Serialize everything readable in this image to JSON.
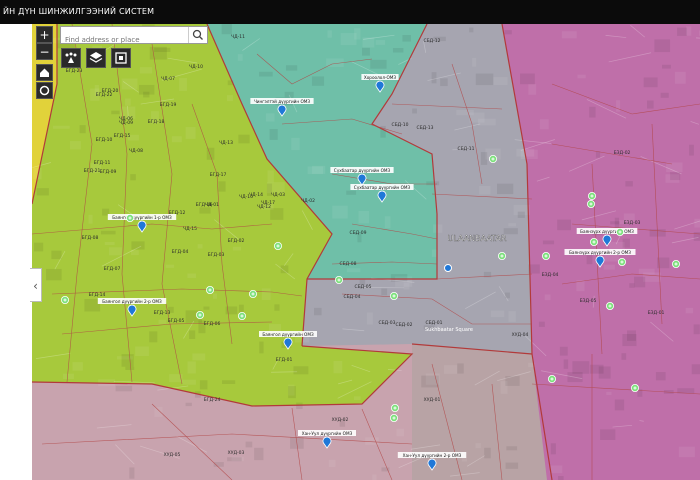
{
  "app": {
    "title": "ЙН ДҮН ШИНЖИЛГЭЭНИЙ СИСТЕМ"
  },
  "search": {
    "placeholder": "Find address or place"
  },
  "controls": {
    "zoom_in": "+",
    "zoom_out": "−",
    "collapse": "‹"
  },
  "icons": [
    "zoom-in-icon",
    "zoom-out-icon",
    "home-icon",
    "locate-icon",
    "legend-icon",
    "layers-icon",
    "basemap-icon",
    "search-icon",
    "collapse-arrow-icon"
  ],
  "colors": {
    "district_yellow": "#e3d33a",
    "district_green": "#a6c83a",
    "district_teal": "#6dbea6",
    "district_gray": "#a8a8b2",
    "district_magenta": "#c06aa8",
    "district_pink": "#c79aa8",
    "boundary": "#b23a3a",
    "marker_blue": "#1f78d8",
    "marker_green": "#6fd06f"
  },
  "districts": {
    "center": "ULAANBAATAR",
    "landmark": "Sukhbaatar Square"
  },
  "zone_labels": [
    "ЧД-11",
    "ЧД-10",
    "ЧД-07",
    "ЧД-08",
    "ЧД-06",
    "ЧД-09",
    "ЧД-13",
    "ЧД-16",
    "ЧД-17",
    "ЧД-14",
    "ЧД-12",
    "ЧД-15",
    "ЧД-01",
    "ЧД-02",
    "ЧД-03",
    "БГД-23",
    "БГД-22",
    "БГД-21",
    "БГД-20",
    "БГД-19",
    "БГД-18",
    "БГД-17",
    "БГД-16",
    "БГД-15",
    "БГД-14",
    "БГД-13",
    "БГД-12",
    "БГД-11",
    "БГД-10",
    "БГД-09",
    "БГД-08",
    "БГД-07",
    "БГД-06",
    "БГД-05",
    "БГД-04",
    "БГД-03",
    "БГД-02",
    "БГД-01",
    "БГД-24",
    "СБД-12",
    "СБД-13",
    "СБД-10",
    "СБД-09",
    "СБД-08",
    "СБД-05",
    "СБД-04",
    "СБД-03",
    "СБД-02",
    "СБД-01",
    "СБД-11",
    "БЗД-02",
    "БЗД-03",
    "БЗД-04",
    "БЗД-05",
    "БЗД-01",
    "ХУД-03",
    "ХУД-02",
    "ХУД-01",
    "ХУД-04",
    "ХУД-05"
  ],
  "station_labels": [
    "Хороолол-ОМЗ",
    "Чингэлтэй дүүргийн ОМЗ",
    "Баянгол дүүргийн 1-р ОМЗ",
    "Баянгол дүүргийн 2-р ОМЗ",
    "Баянгол дүүргийн ОМЗ",
    "Сүхбаатар дүүргийн ОМЗ",
    "Сүхбаатар дүүргийн ОМЗ",
    "Баянзүрх дүүргийн ОМЗ",
    "Баянзүрх дүүргийн 2-р ОМЗ",
    "Хан-Уул дүүргийн ОМЗ",
    "Хан-Уул дүүргийн 2-р ОМЗ"
  ]
}
